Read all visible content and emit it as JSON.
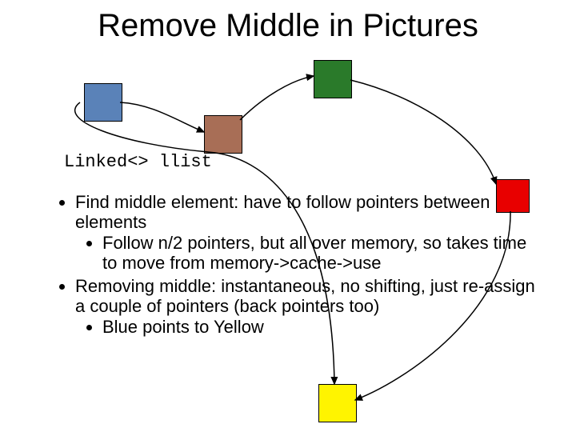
{
  "title": "Remove Middle in Pictures",
  "code_label": "Linked<> llist",
  "bullets": {
    "b1": "Find middle element: have to follow pointers between elements",
    "b1a": "Follow n/2 pointers, but all over memory, so takes time to move from memory->cache->use",
    "b2": "Removing middle: instantaneous, no shifting, just re-assign a couple of pointers (back pointers too)",
    "b2a": "Blue points to Yellow"
  },
  "nodes": {
    "blue": "linked-node-blue",
    "brown": "linked-node-brown",
    "green": "linked-node-green",
    "red": "linked-node-red",
    "yellow": "linked-node-yellow"
  }
}
